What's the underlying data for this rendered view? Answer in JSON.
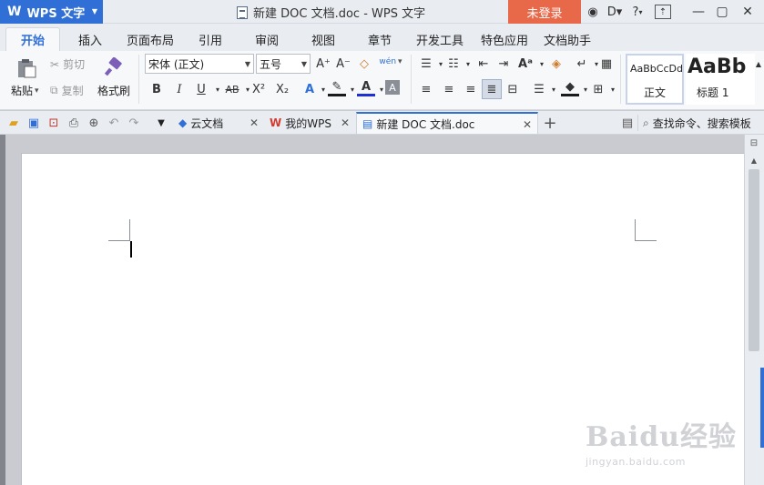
{
  "titlebar": {
    "app_logo": "W",
    "app_name": "WPS 文字",
    "document_title": "新建 DOC 文档.doc - WPS 文字",
    "login_label": "未登录",
    "help_label": "?"
  },
  "ribbon_tabs": [
    "开始",
    "插入",
    "页面布局",
    "引用",
    "审阅",
    "视图",
    "章节",
    "开发工具",
    "特色应用",
    "文档助手"
  ],
  "ribbon": {
    "paste_label": "粘贴",
    "cut_label": "剪切",
    "copy_label": "复制",
    "format_painter_label": "格式刷",
    "font_name": "宋体 (正文)",
    "font_size": "五号",
    "bold": "B",
    "italic": "I",
    "underline": "U",
    "strike": "AB",
    "superscript": "X²",
    "subscript": "X₂",
    "grow_font": "A⁺",
    "shrink_font": "A⁻",
    "pinyin": "wén",
    "styles": [
      {
        "preview": "AaBbCcDd",
        "name": "正文"
      },
      {
        "preview": "AaBb",
        "name": "标题 1"
      }
    ]
  },
  "tabs": [
    {
      "label": "云文档"
    },
    {
      "label": "我的WPS"
    },
    {
      "label": "新建 DOC 文档.doc"
    }
  ],
  "search_placeholder": "查找命令、搜索模板",
  "watermark": {
    "main": "Baidu经验",
    "url": "jingyan.baidu.com"
  },
  "colors": {
    "accent": "#2f6fd6",
    "login": "#e8684a",
    "chrome": "#e9ecf1",
    "page_bg": "#c9cbd0"
  }
}
